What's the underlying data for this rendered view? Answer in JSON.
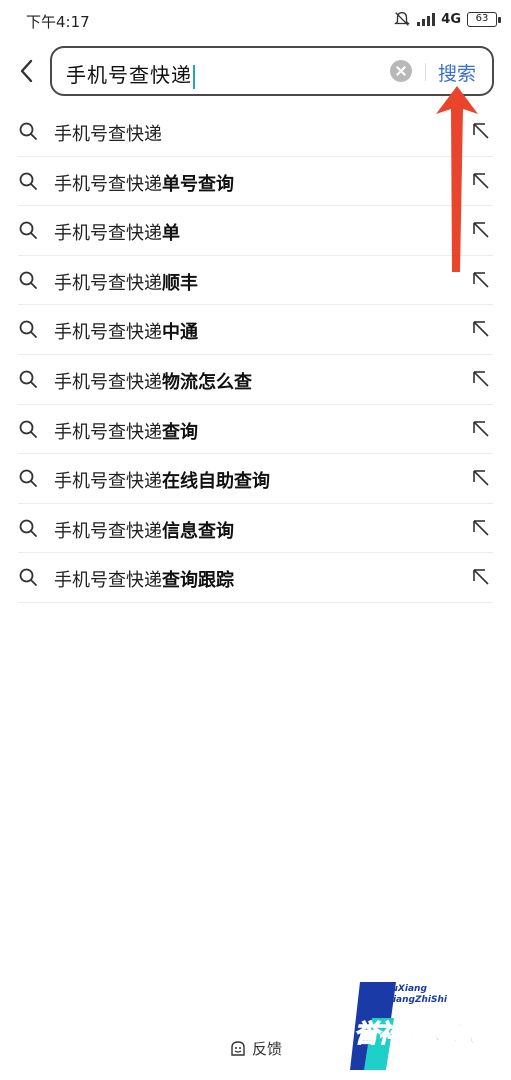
{
  "status": {
    "time": "下午4:17",
    "network": "4G",
    "battery": "63"
  },
  "search": {
    "query": "手机号查快递",
    "button_label": "搜索"
  },
  "suggestions": [
    {
      "prefix": "手机号查快递",
      "suffix": ""
    },
    {
      "prefix": "手机号查快递",
      "suffix": "单号查询"
    },
    {
      "prefix": "手机号查快递",
      "suffix": "单"
    },
    {
      "prefix": "手机号查快递",
      "suffix": "顺丰"
    },
    {
      "prefix": "手机号查快递",
      "suffix": "中通"
    },
    {
      "prefix": "手机号查快递",
      "suffix": "物流怎么查"
    },
    {
      "prefix": "手机号查快递",
      "suffix": "查询"
    },
    {
      "prefix": "手机号查快递",
      "suffix": "在线自助查询"
    },
    {
      "prefix": "手机号查快递",
      "suffix": "信息查询"
    },
    {
      "prefix": "手机号查快递",
      "suffix": "查询跟踪"
    }
  ],
  "footer": {
    "feedback_label": "反馈"
  },
  "watermark": {
    "line1": "YuXiang",
    "line2": "XiangZhiShi",
    "text": "誉祥祥知识"
  },
  "colors": {
    "accent": "#3a6fd0",
    "annotation": "#e8452c",
    "watermark_cyan": "#1fd0c8",
    "watermark_blue": "#1a3aa8"
  },
  "icons": {
    "back": "chevron-left-icon",
    "clear": "clear-circle-icon",
    "search": "search-icon",
    "fill": "arrow-up-left-icon",
    "feedback": "feedback-icon"
  }
}
